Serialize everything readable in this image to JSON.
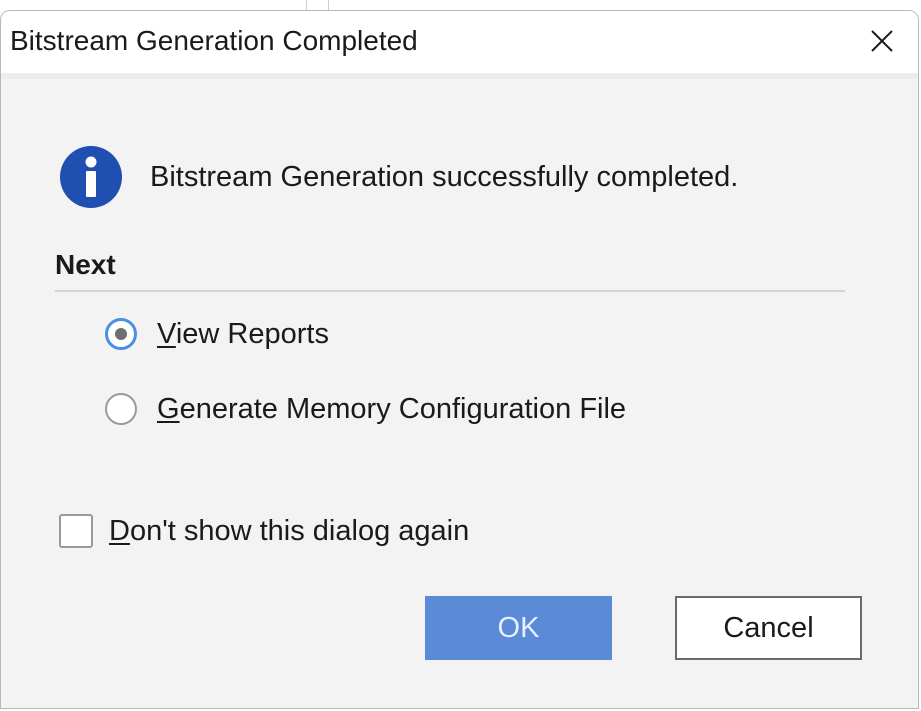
{
  "dialog": {
    "title": "Bitstream Generation Completed",
    "close_icon": "close-icon",
    "message_icon": "info-icon",
    "message": "Bitstream Generation successfully completed.",
    "section_title": "Next",
    "options": [
      {
        "mnemonic": "V",
        "rest": "iew Reports",
        "selected": true
      },
      {
        "mnemonic": "G",
        "rest": "enerate Memory Configuration File",
        "selected": false
      }
    ],
    "dont_show": {
      "mnemonic": "D",
      "rest": "on't show this dialog again",
      "checked": false
    },
    "ok_label": "OK",
    "cancel_label": "Cancel"
  },
  "colors": {
    "accent": "#4a8fe0",
    "ok_button_bg": "#5b8ad6",
    "info_icon": "#1f4fb0"
  }
}
